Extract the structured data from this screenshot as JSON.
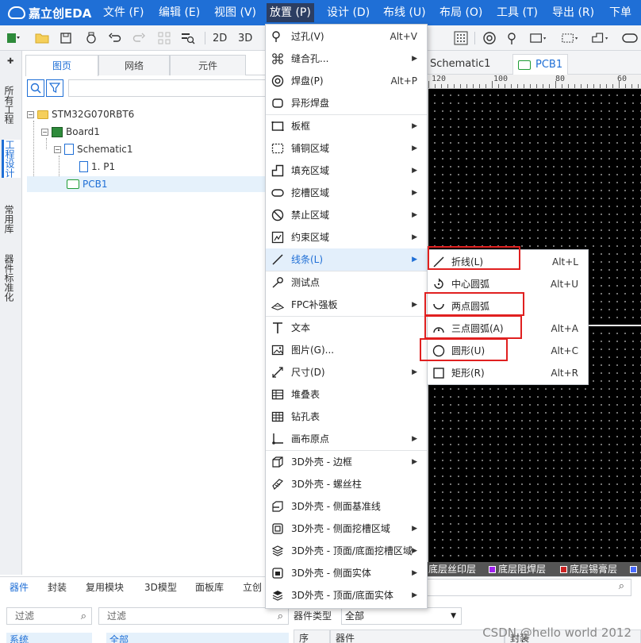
{
  "app": {
    "logo": "嘉立创EDA",
    "menus": [
      "文件 (F)",
      "编辑 (E)",
      "视图 (V)",
      "放置 (P)",
      "设计 (D)",
      "布线 (U)",
      "布局 (O)",
      "工具 (T)",
      "导出 (R)",
      "下单"
    ],
    "active_menu_index": 3
  },
  "toolbar": {
    "view_2d": "2D",
    "view_3d": "3D"
  },
  "vertical_tabs": [
    "所有工程",
    "工程设计",
    "常用库",
    "器件标准化"
  ],
  "left_panel": {
    "tabs": [
      "图页",
      "网络",
      "元件"
    ],
    "tree": [
      {
        "label": "STM32G070RBT6"
      },
      {
        "label": "Board1"
      },
      {
        "label": "Schematic1"
      },
      {
        "label": "1. P1"
      },
      {
        "label": "PCB1",
        "selected": true
      }
    ]
  },
  "doc_tabs": [
    "Schematic1",
    "PCB1"
  ],
  "ruler": {
    "labels": [
      "120",
      "100",
      "80",
      "60"
    ]
  },
  "layers": [
    "底层丝印层",
    "底层阻焊层",
    "底层锡膏层"
  ],
  "layer_colors": [
    "#ffffff",
    "#a020f0",
    "#cc2222",
    "#4a6cff"
  ],
  "bottom_panel": {
    "tabs": [
      "器件",
      "封装",
      "复用模块",
      "3D模型",
      "面板库",
      "立创"
    ],
    "filter_placeholder": "过滤",
    "filter2_placeholder": "过滤",
    "list_first": "系统",
    "list2_first": "全部",
    "type_label": "器件类型",
    "type_value": "全部",
    "columns": [
      "序",
      "器件",
      "封装"
    ]
  },
  "place_menu": {
    "items": [
      {
        "icon": "via-icon",
        "label": "过孔(V)",
        "shortcut": "Alt+V"
      },
      {
        "icon": "stitch-holes-icon",
        "label": "缝合孔...",
        "submenu": true
      },
      {
        "icon": "pad-icon",
        "label": "焊盘(P)",
        "shortcut": "Alt+P"
      },
      {
        "icon": "irregular-pad-icon",
        "label": "异形焊盘"
      },
      {
        "icon": "board-frame-icon",
        "label": "板框",
        "submenu": true
      },
      {
        "icon": "copper-area-icon",
        "label": "铺铜区域",
        "submenu": true
      },
      {
        "icon": "fill-area-icon",
        "label": "填充区域",
        "submenu": true
      },
      {
        "icon": "slot-area-icon",
        "label": "挖槽区域",
        "submenu": true
      },
      {
        "icon": "keepout-icon",
        "label": "禁止区域",
        "submenu": true
      },
      {
        "icon": "constraint-area-icon",
        "label": "约束区域",
        "submenu": true
      },
      {
        "icon": "line-icon",
        "label": "线条(L)",
        "submenu": true,
        "highlighted": true
      },
      {
        "icon": "test-point-icon",
        "label": "测试点"
      },
      {
        "icon": "fpc-stiffener-icon",
        "label": "FPC补强板",
        "submenu": true
      },
      {
        "icon": "text-icon",
        "label": "文本"
      },
      {
        "icon": "image-icon",
        "label": "图片(G)..."
      },
      {
        "icon": "dimension-icon",
        "label": "尺寸(D)",
        "submenu": true
      },
      {
        "icon": "stackup-table-icon",
        "label": "堆叠表"
      },
      {
        "icon": "drill-table-icon",
        "label": "钻孔表"
      },
      {
        "icon": "canvas-origin-icon",
        "label": "画布原点",
        "submenu": true
      },
      {
        "icon": "shell-frame-icon",
        "label": "3D外壳 - 边框",
        "submenu": true
      },
      {
        "icon": "screw-post-icon",
        "label": "3D外壳 - 螺丝柱"
      },
      {
        "icon": "side-datum-icon",
        "label": "3D外壳 - 侧面基准线"
      },
      {
        "icon": "side-slot-icon",
        "label": "3D外壳 - 侧面挖槽区域",
        "submenu": true
      },
      {
        "icon": "top-slot-icon",
        "label": "3D外壳 - 顶面/底面挖槽区域",
        "submenu": true
      },
      {
        "icon": "side-solid-icon",
        "label": "3D外壳 - 侧面实体",
        "submenu": true
      },
      {
        "icon": "top-solid-icon",
        "label": "3D外壳 - 顶面/底面实体",
        "submenu": true
      }
    ]
  },
  "line_submenu": {
    "items": [
      {
        "icon": "polyline-icon",
        "label": "折线(L)",
        "shortcut": "Alt+L",
        "annotated": true
      },
      {
        "icon": "center-arc-icon",
        "label": "中心圆弧",
        "shortcut": "Alt+U"
      },
      {
        "icon": "two-point-arc-icon",
        "label": "两点圆弧",
        "shortcut": "",
        "annotated": true
      },
      {
        "icon": "three-point-arc-icon",
        "label": "三点圆弧(A)",
        "shortcut": "Alt+A",
        "annotated": true
      },
      {
        "icon": "circle-icon",
        "label": "圆形(U)",
        "shortcut": "Alt+C",
        "annotated": true
      },
      {
        "icon": "rectangle-icon",
        "label": "矩形(R)",
        "shortcut": "Alt+R"
      }
    ]
  },
  "watermark": "CSDN @hello world 2012"
}
